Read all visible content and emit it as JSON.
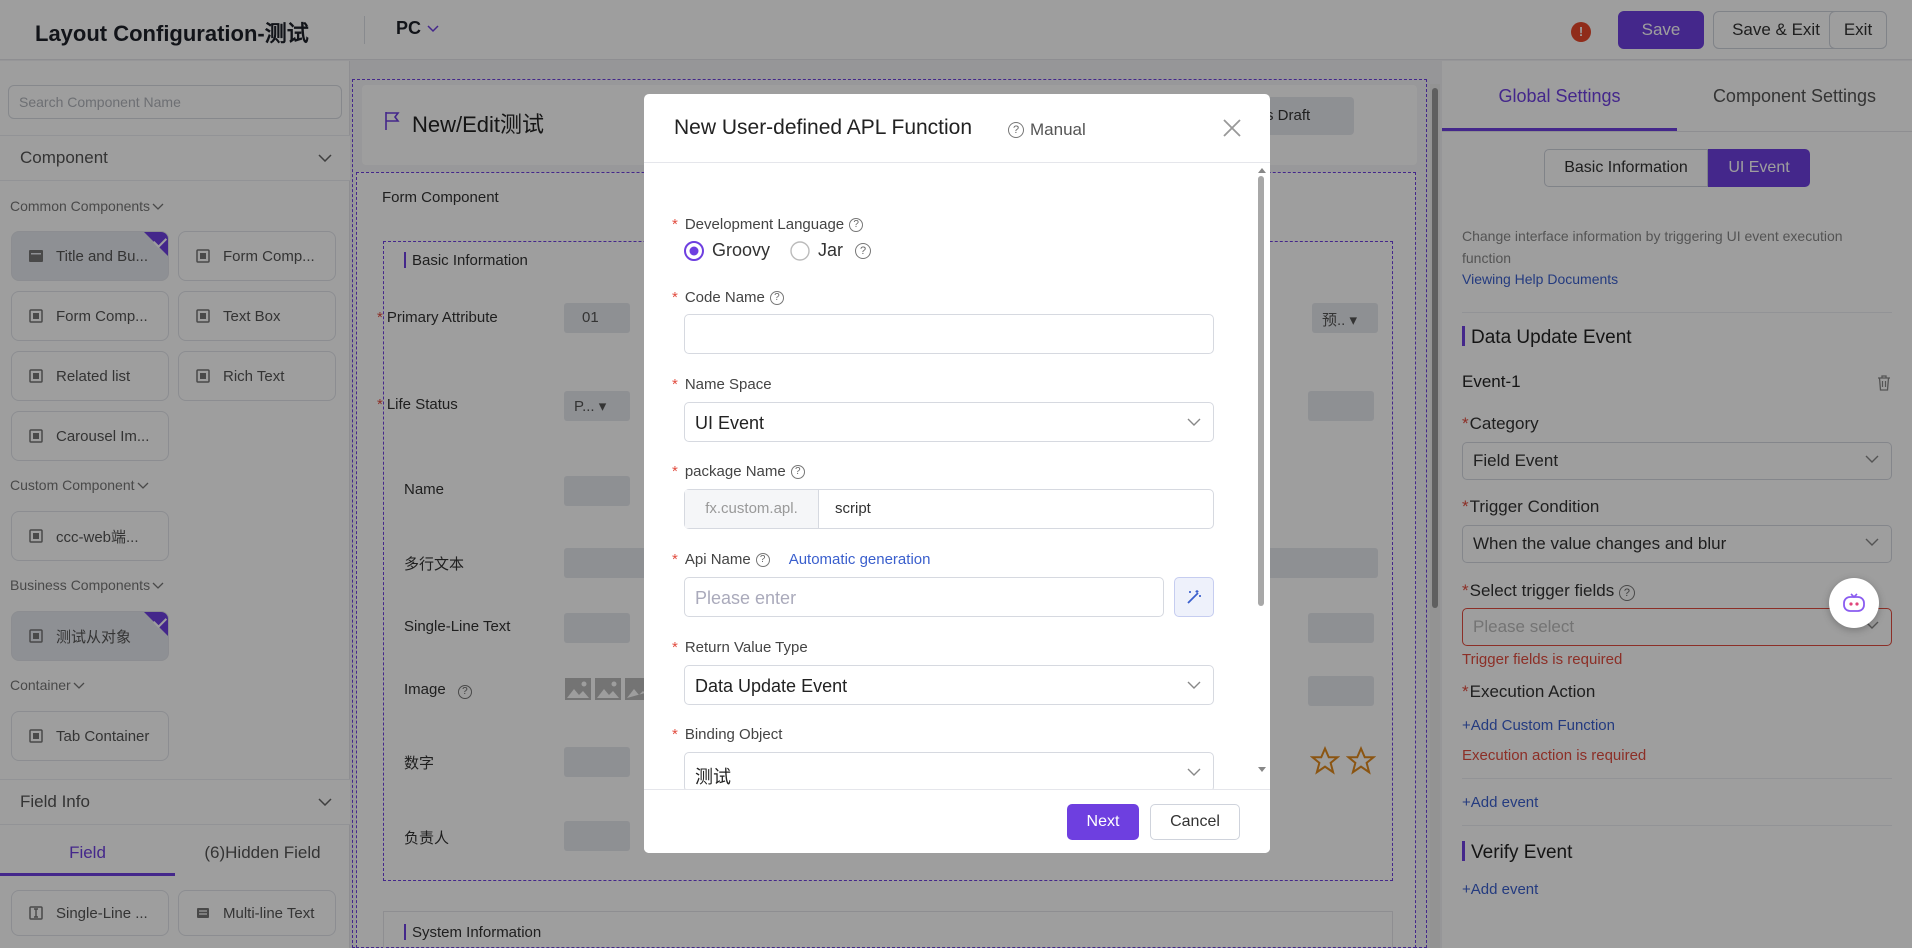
{
  "header": {
    "title": "Layout Configuration-测试",
    "device": "PC",
    "warning": "!",
    "save": "Save",
    "save_exit": "Save & Exit",
    "exit": "Exit"
  },
  "left": {
    "search_placeholder": "Search Component Name",
    "component_section": "Component",
    "common_group": "Common Components",
    "common_items": [
      "Title and Bu...",
      "Form Comp...",
      "Form Comp...",
      "Text Box",
      "Related list",
      "Rich Text",
      "Carousel Im..."
    ],
    "custom_group": "Custom Component",
    "custom_items": [
      "ccc-web端..."
    ],
    "business_group": "Business Components",
    "business_items": [
      "测试从对象"
    ],
    "container_group": "Container",
    "container_items": [
      "Tab Container"
    ],
    "field_info": "Field Info",
    "tabs": [
      "Field",
      "(6)Hidden Field"
    ],
    "field_items": [
      "Single-Line ...",
      "Multi-line Text"
    ]
  },
  "canvas": {
    "page_title": "New/Edit测试",
    "draft_btn": "s Draft",
    "form_component": "Form Component",
    "basic_info": "Basic Information",
    "fields": [
      "Primary Attribute",
      "Life Status",
      "Name",
      "多行文本",
      "Single-Line Text",
      "Image",
      "数字",
      "负责人"
    ],
    "primary_value": "01",
    "status_value": "P...",
    "preset_value": "预..",
    "system_info": "System Information"
  },
  "right": {
    "tabs": [
      "Global Settings",
      "Component Settings"
    ],
    "segments": [
      "Basic Information",
      "UI Event"
    ],
    "desc": "Change interface information by triggering UI event execution function",
    "help_link": "Viewing Help Documents",
    "data_update_title": "Data Update Event",
    "event_name": "Event-1",
    "category_label": "Category",
    "category_value": "Field Event",
    "trigger_label": "Trigger Condition",
    "trigger_value": "When the value changes and blur",
    "select_fields_label": "Select trigger fields",
    "select_fields_placeholder": "Please select",
    "fields_error": "Trigger fields is required",
    "exec_label": "Execution Action",
    "add_custom": "+Add Custom Function",
    "exec_error": "Execution action is required",
    "add_event_1": "+Add event",
    "verify_title": "Verify Event",
    "add_event_2": "+Add event"
  },
  "modal": {
    "title": "New User-defined APL Function",
    "manual": "Manual",
    "dev_lang_label": "Development Language",
    "lang_options": [
      "Groovy",
      "Jar"
    ],
    "lang_selected": "Groovy",
    "code_name_label": "Code Name",
    "code_name_value": "",
    "namespace_label": "Name Space",
    "namespace_value": "UI Event",
    "package_label": "package Name",
    "package_prefix": "fx.custom.apl.",
    "package_value": "script",
    "api_label": "Api Name",
    "auto_gen": "Automatic generation",
    "api_placeholder": "Please enter",
    "return_label": "Return Value Type",
    "return_value": "Data Update Event",
    "binding_label": "Binding Object",
    "binding_value": "测试",
    "next": "Next",
    "cancel": "Cancel"
  },
  "colors": {
    "accent": "#6e3fe0",
    "error": "#e24c3f",
    "link": "#3a5fcd",
    "star": "#e08a1e"
  }
}
